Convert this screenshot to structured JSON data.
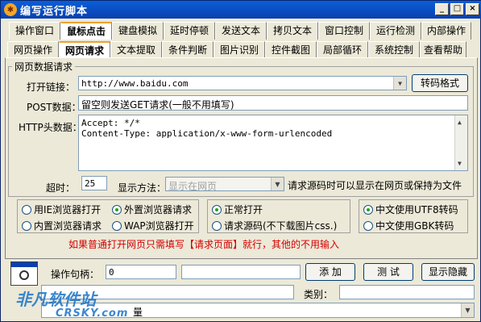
{
  "window": {
    "title": "编写运行脚本",
    "min": "0",
    "max": "1",
    "close": "r"
  },
  "tabs_row1": [
    "操作窗口",
    "鼠标点击",
    "键盘模拟",
    "延时停顿",
    "发送文本",
    "拷贝文本",
    "窗口控制",
    "运行检测",
    "内部操作"
  ],
  "tabs_row2": [
    "网页操作",
    "网页请求",
    "文本提取",
    "条件判断",
    "图片识别",
    "控件截图",
    "局部循环",
    "系统控制",
    "查看帮助"
  ],
  "selected_tab_row1": "鼠标点击",
  "selected_tab_row2": "网页请求",
  "group": {
    "title": "网页数据请求"
  },
  "open_link": {
    "label": "打开链接：",
    "value": "http://www.baidu.com",
    "button": "转码格式"
  },
  "post": {
    "label": "POST数据：",
    "value": "留空则发送GET请求(一般不用填写)"
  },
  "http_header": {
    "label": "HTTP头数据：",
    "line1": "Accept: */*",
    "line2": "Content-Type: application/x-www-form-urlencoded"
  },
  "timeout": {
    "label": "超时：",
    "value": "25"
  },
  "display": {
    "label": "显示方法：",
    "value": "显示在网页",
    "hint": "请求源码时可以显示在网页或保持为文件"
  },
  "radios": {
    "ie": "用IE浏览器打开",
    "external": "外置浏览器请求",
    "builtin": "内置浏览器请求",
    "wap": "WAP浏览器打开",
    "normal": "正常打开",
    "source": "请求源码(不下载图片css.)",
    "utf8": "中文使用UTF8转码",
    "gbk": "中文使用GBK转码"
  },
  "warning": "如果普通打开网页只需填写【请求页面】就行，其他的不用输入",
  "bottom": {
    "handle_label": "操作句柄：",
    "handle_value": "0",
    "add": "添 加",
    "test": "测 试",
    "toggle": "显示隐藏",
    "type_label": "类别：",
    "var_partial": "量"
  },
  "watermark": {
    "line1": "非凡软件站",
    "line2": "CRSKY.com"
  }
}
